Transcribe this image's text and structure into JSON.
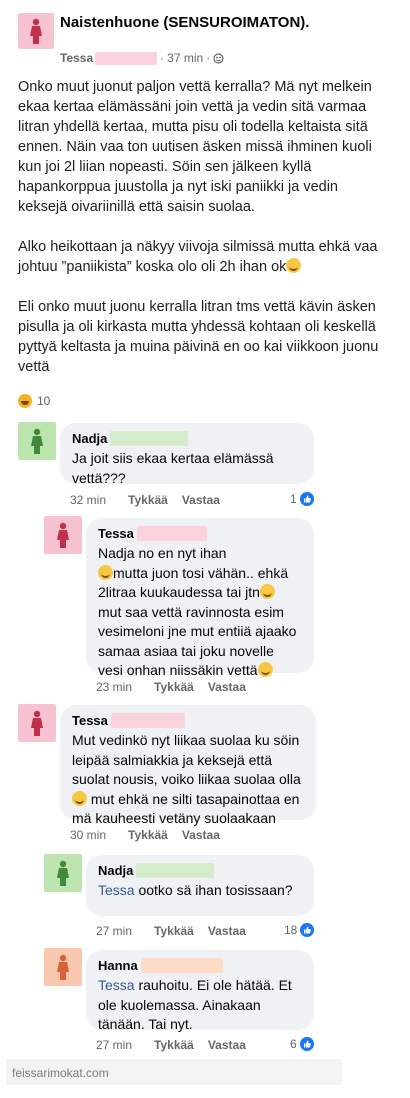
{
  "post": {
    "group_name": "Naistenhuone (SENSUROIMATON).",
    "author": "Tessa",
    "time": "37 min",
    "separator": "·",
    "paragraphs": [
      "Onko muut juonut paljon vettä kerralla? Mä nyt melkein ekaa kertaa elämässäni join vettä ja vedin sitä varmaa litran yhdellä kertaa, mutta pisu oli todella keltaista sitä ennen. Näin vaa ton uutisen äsken missä ihminen kuoli kun joi 2l liian nopeasti. Söin sen jälkeen kyllä hapankorppua juustolla ja nyt iski paniikki ja vedin keksejä oivariinillä että saisin suolaa.",
      "Alko heikottaan ja näkyy viivoja silmissä mutta ehkä vaa johtuu ”paniikista” koska olo oli 2h ihan ok",
      "Eli onko muut juonu kerralla litran tms vettä kävin äsken pisulla ja oli kirkasta mutta yhdessä kohtaan oli keskellä pyttyä keltasta ja muina päivinä en oo kai viikkoon juonu vettä"
    ],
    "reaction_count": "10"
  },
  "labels": {
    "like": "Tykkää",
    "reply": "Vastaa"
  },
  "comments": [
    {
      "name": "Nadja",
      "text": "Ja joit siis ekaa kertaa elämässä vettä???",
      "time": "32 min",
      "likes": "1"
    },
    {
      "name": "Tessa",
      "text_a": "Nadja no en nyt ihan",
      "text_b": "mutta juon tosi vähän.. ehkä 2litraa kuukaudessa tai jtn",
      "text_c": "mut saa vettä ravinnosta esim vesimeloni jne mut entiiä ajaako samaa asiaa tai joku novelle vesi onhan niissäkin vettä",
      "time": "23 min"
    },
    {
      "name": "Tessa",
      "text_a": "Mut vedinkö nyt liikaa suolaa ku söin leipää salmiakkia ja keksejä että suolat nousis, voiko liikaa suolaa olla",
      "text_b": "mut ehkä ne silti tasapainottaa en mä kauheesti vetäny suolaakaan",
      "time": "30 min"
    },
    {
      "name": "Nadja",
      "mention": "Tessa",
      "text": "ootko sä ihan tosissaan?",
      "time": "27 min",
      "likes": "18"
    },
    {
      "name": "Hanna",
      "mention": "Tessa",
      "text": "rauhoitu. Ei ole hätää. Et ole kuolemassa. Ainakaan tänään. Tai nyt.",
      "time": "27 min",
      "likes": "6"
    }
  ],
  "footer": {
    "watermark": "feissarimokat.com"
  },
  "colors": {
    "pink_avatar": "#f7c3d0",
    "green_avatar": "#bde3ae",
    "peach_avatar": "#f9c8ae",
    "link": "#385898",
    "like_blue": "#1877f2"
  }
}
